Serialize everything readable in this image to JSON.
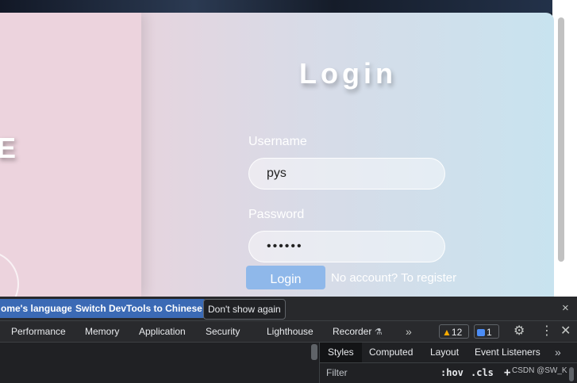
{
  "login": {
    "title": "Login",
    "username_label": "Username",
    "username_value": "pys",
    "password_label": "Password",
    "password_value": "••••••",
    "button_label": "Login",
    "register_text": "No account? To register",
    "welcome_letter": "E"
  },
  "devtools": {
    "infobar": {
      "language_button": "ome's language",
      "switch_button": "Switch DevTools to Chinese",
      "dismiss_button": "Don't show again",
      "close": "×"
    },
    "tabs": [
      {
        "label": "Performance"
      },
      {
        "label": "Memory"
      },
      {
        "label": "Application"
      },
      {
        "label": "Security"
      },
      {
        "label": "Lighthouse"
      },
      {
        "label": "Recorder"
      }
    ],
    "overflow": "»",
    "warnings_count": "12",
    "messages_count": "1",
    "styles_tabs": [
      {
        "label": "Styles"
      },
      {
        "label": "Computed"
      },
      {
        "label": "Layout"
      },
      {
        "label": "Event Listeners"
      }
    ],
    "filter_placeholder": "Filter",
    "hov_label": ":hov",
    "cls_label": ".cls",
    "add_label": "+"
  },
  "watermark": "CSDN @SW_K",
  "colors": {
    "card_left": "#edd3dc",
    "card_right": "#c8e3ef",
    "button": "#8fb8ea",
    "devtools_bg": "#202124",
    "primary_button": "#3b6ab5"
  }
}
